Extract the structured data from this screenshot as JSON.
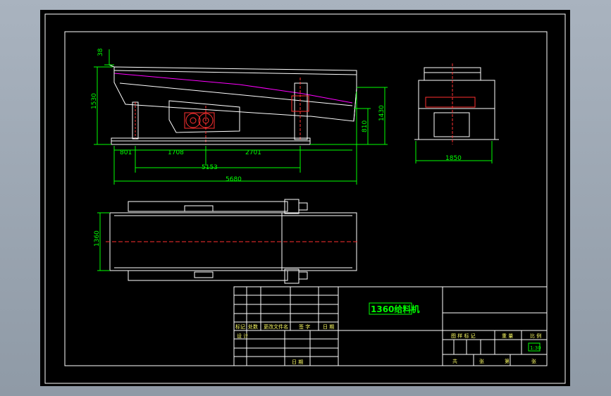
{
  "colors": {
    "background": "#000000",
    "frame": "#ffffff",
    "dimension": "#00ff00",
    "centerline": "#ff0000",
    "profile": "#ff00ff",
    "motor": "#ff3030",
    "title_text": "#00ff00",
    "table_label": "#ffff66"
  },
  "dimensions": {
    "top_small": "38",
    "left_height": "1530",
    "bottom_1": "801",
    "bottom_2": "1708",
    "bottom_3": "2701",
    "mount_length": "5153",
    "overall_length": "5680",
    "right_height_1": "1430",
    "right_height_2": "810",
    "end_width": "1850",
    "plan_width": "1360"
  },
  "title_block": {
    "drawing_title": "1360给料机",
    "row_labels": [
      "标记",
      "处数",
      "更改文件名",
      "签 字",
      "日 期"
    ],
    "design": "设 计",
    "date": "日 期",
    "drawing_no_labels": [
      "图 样 标 记",
      "重 量",
      "比 例"
    ],
    "scale": "1:30",
    "sheet_labels": [
      "共",
      "张",
      "第",
      "张"
    ]
  }
}
